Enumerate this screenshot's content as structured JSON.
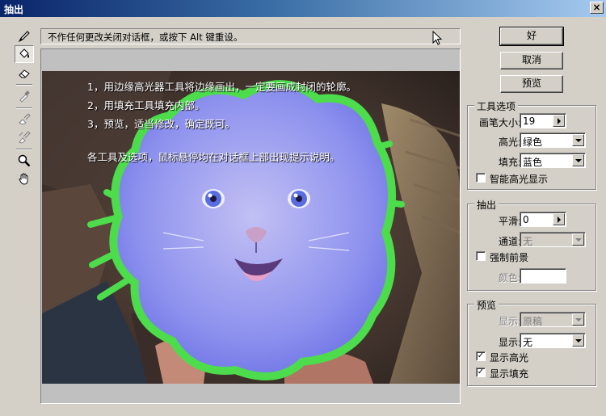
{
  "window": {
    "title": "抽出",
    "close_glyph": "×"
  },
  "tools": [
    {
      "icon": "edge-highlighter-icon",
      "active": false
    },
    {
      "icon": "fill-bucket-icon",
      "active": true
    },
    {
      "icon": "eraser-icon",
      "active": false
    },
    {
      "icon": "eyedropper-icon",
      "active": false
    },
    {
      "icon": "cleanup-tool-icon",
      "active": false
    },
    {
      "icon": "edge-touchup-icon",
      "active": false
    },
    {
      "icon": "zoom-icon",
      "active": false
    },
    {
      "icon": "hand-icon",
      "active": false
    }
  ],
  "hint": {
    "text": "不作任何更改关闭对话框，或按下 Alt 键重设。"
  },
  "instructions": {
    "line1": "1，用边缘高光器工具将边缘画出，一定要画成封闭的轮廓。",
    "line2": "2，用填充工具填充内部。",
    "line3": "3，预览，适当修改，确定既可。",
    "line4": "各工具及选项，鼠标悬停均在对话框上部出现提示说明。"
  },
  "buttons": {
    "ok": "好",
    "cancel": "取消",
    "preview": "预览"
  },
  "tool_options": {
    "title": "工具选项",
    "brush_size_label": "画笔大小:",
    "brush_size_value": "19",
    "highlight_label": "高光:",
    "highlight_value": "绿色",
    "fill_label": "填充:",
    "fill_value": "蓝色",
    "smart_highlight_label": "智能高光显示",
    "smart_highlight_checked": false
  },
  "extraction": {
    "title": "抽出",
    "smooth_label": "平滑:",
    "smooth_value": "0",
    "channel_label": "通道:",
    "channel_value": "无",
    "force_foreground_label": "强制前景",
    "force_foreground_checked": false,
    "color_label": "颜色:"
  },
  "preview": {
    "title": "预览",
    "show_label_1": "显示:",
    "show_value_1": "原稿",
    "show_label_2": "显示:",
    "show_value_2": "无",
    "show_highlight_label": "显示高光",
    "show_highlight_checked": true,
    "show_fill_label": "显示填充",
    "show_fill_checked": true,
    "check_glyph": "✓"
  },
  "colors": {
    "highlight": "#4cdc4c",
    "fill": "#7a7ff0",
    "title_bar": "#0a246a"
  }
}
